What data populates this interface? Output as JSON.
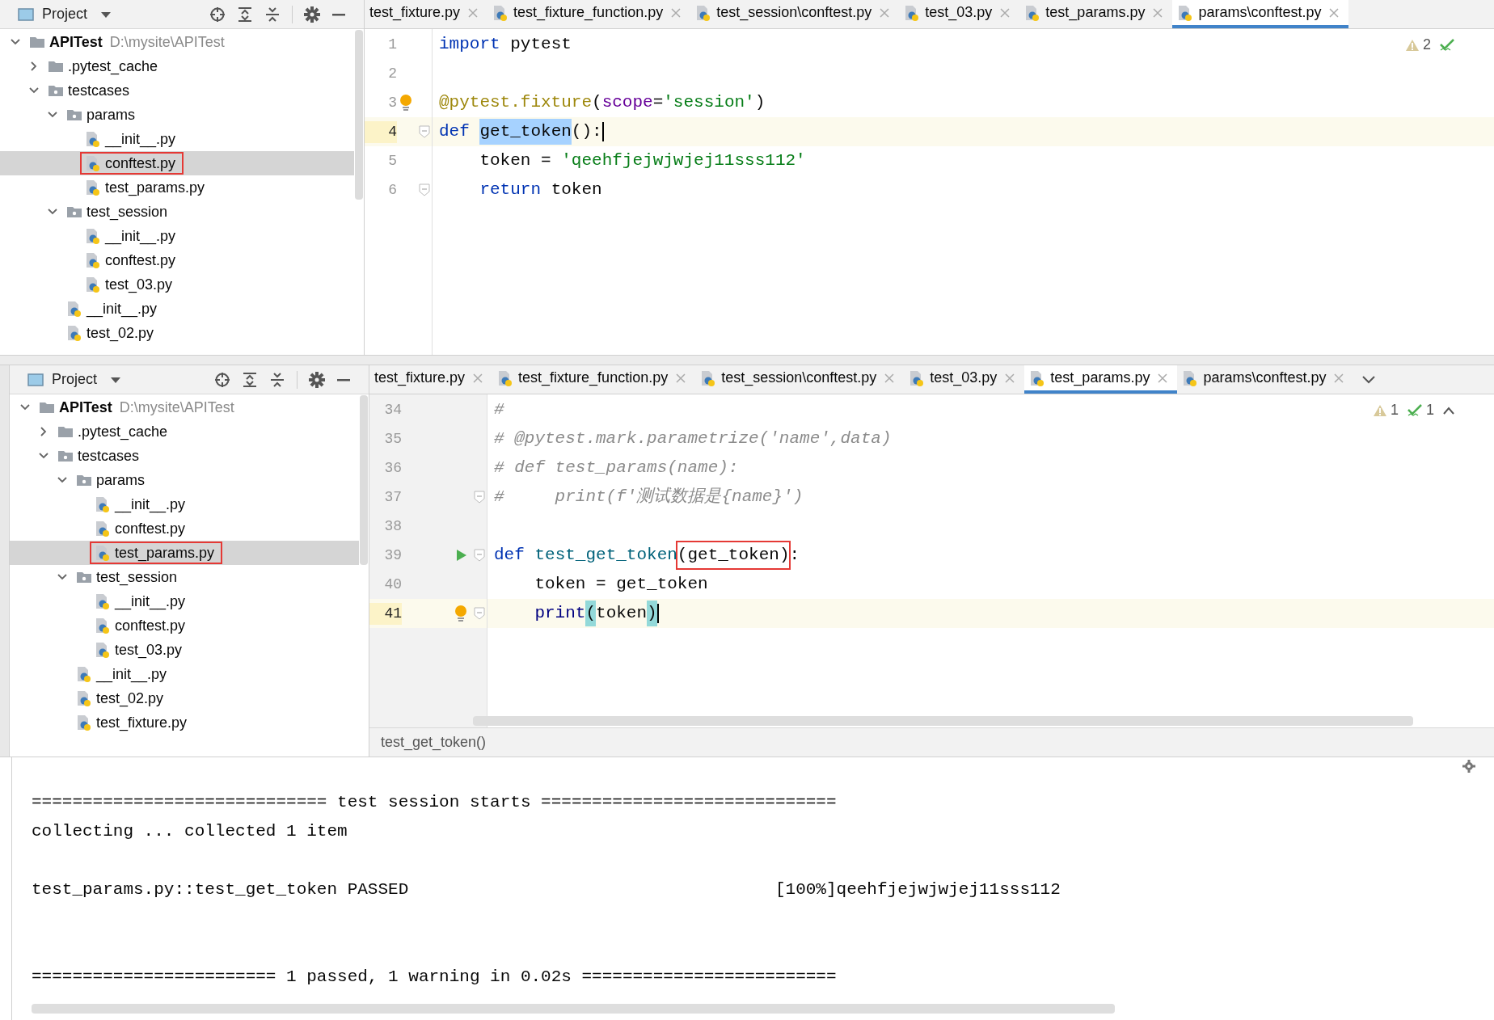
{
  "top_pane": {
    "project_panel": {
      "title": "Project",
      "tree": [
        {
          "label": "APITest",
          "path": "D:\\mysite\\APITest",
          "kind": "root",
          "expanded": true,
          "selected": false,
          "boxed": false,
          "children": [
            {
              "label": ".pytest_cache",
              "kind": "folder",
              "expanded": false,
              "selected": false,
              "boxed": false
            },
            {
              "label": "testcases",
              "kind": "package",
              "expanded": true,
              "selected": false,
              "boxed": false,
              "children": [
                {
                  "label": "params",
                  "kind": "package",
                  "expanded": true,
                  "selected": false,
                  "boxed": false,
                  "children": [
                    {
                      "label": "__init__.py",
                      "kind": "python",
                      "selected": false,
                      "boxed": false
                    },
                    {
                      "label": "conftest.py",
                      "kind": "python",
                      "selected": true,
                      "boxed": true
                    },
                    {
                      "label": "test_params.py",
                      "kind": "python",
                      "selected": false,
                      "boxed": false
                    }
                  ]
                },
                {
                  "label": "test_session",
                  "kind": "package",
                  "expanded": true,
                  "selected": false,
                  "boxed": false,
                  "children": [
                    {
                      "label": "__init__.py",
                      "kind": "python",
                      "selected": false,
                      "boxed": false
                    },
                    {
                      "label": "conftest.py",
                      "kind": "python",
                      "selected": false,
                      "boxed": false
                    },
                    {
                      "label": "test_03.py",
                      "kind": "python",
                      "selected": false,
                      "boxed": false
                    }
                  ]
                },
                {
                  "label": "__init__.py",
                  "kind": "python",
                  "selected": false,
                  "boxed": false
                },
                {
                  "label": "test_02.py",
                  "kind": "python",
                  "selected": false,
                  "boxed": false
                }
              ]
            }
          ]
        }
      ]
    },
    "tabs": [
      {
        "label": "test_fixture.py",
        "icon": false,
        "selected": false
      },
      {
        "label": "test_fixture_function.py",
        "icon": true,
        "selected": false
      },
      {
        "label": "test_session\\conftest.py",
        "icon": true,
        "selected": false
      },
      {
        "label": "test_03.py",
        "icon": true,
        "selected": false
      },
      {
        "label": "test_params.py",
        "icon": true,
        "selected": false
      },
      {
        "label": "params\\conftest.py",
        "icon": true,
        "selected": true
      }
    ],
    "inspection": {
      "warnings": "2"
    },
    "lines": [
      {
        "number": "1",
        "current": false,
        "tokens": [
          {
            "text": "import",
            "kind": "keyword"
          },
          {
            "text": " pytest",
            "kind": "plain"
          }
        ]
      },
      {
        "number": "2",
        "current": false
      },
      {
        "number": "3",
        "current": false,
        "bulb": true,
        "tokens": [
          {
            "text": "@pytest.fixture",
            "kind": "decorator"
          },
          {
            "text": "(",
            "kind": "plain"
          },
          {
            "text": "scope",
            "kind": "param"
          },
          {
            "text": "=",
            "kind": "plain"
          },
          {
            "text": "'session'",
            "kind": "string"
          },
          {
            "text": ")",
            "kind": "plain"
          }
        ]
      },
      {
        "number": "4",
        "current": true,
        "fold": true,
        "tokens": [
          {
            "text": "def ",
            "kind": "keyword"
          },
          {
            "text": "get_token",
            "kind": "plain",
            "selected": true
          },
          {
            "text": "():",
            "kind": "plain"
          }
        ]
      },
      {
        "number": "5",
        "current": false,
        "tokens": [
          {
            "text": "    token = ",
            "kind": "plain"
          },
          {
            "text": "'qeehfjejwjwjej11sss112'",
            "kind": "string"
          }
        ]
      },
      {
        "number": "6",
        "current": false,
        "fold": true,
        "tokens": [
          {
            "text": "    return",
            "kind": "keyword"
          },
          {
            "text": " token",
            "kind": "plain"
          }
        ]
      }
    ]
  },
  "bottom_pane": {
    "project_panel": {
      "title": "Project",
      "tree": [
        {
          "label": "APITest",
          "path": "D:\\mysite\\APITest",
          "kind": "root",
          "expanded": true,
          "selected": false,
          "boxed": false,
          "children": [
            {
              "label": ".pytest_cache",
              "kind": "folder",
              "expanded": false,
              "selected": false,
              "boxed": false
            },
            {
              "label": "testcases",
              "kind": "package",
              "expanded": true,
              "selected": false,
              "boxed": false,
              "children": [
                {
                  "label": "params",
                  "kind": "package",
                  "expanded": true,
                  "selected": false,
                  "boxed": false,
                  "children": [
                    {
                      "label": "__init__.py",
                      "kind": "python",
                      "selected": false,
                      "boxed": false
                    },
                    {
                      "label": "conftest.py",
                      "kind": "python",
                      "selected": false,
                      "boxed": false
                    },
                    {
                      "label": "test_params.py",
                      "kind": "python",
                      "selected": true,
                      "boxed": true
                    }
                  ]
                },
                {
                  "label": "test_session",
                  "kind": "package",
                  "expanded": true,
                  "selected": false,
                  "boxed": false,
                  "children": [
                    {
                      "label": "__init__.py",
                      "kind": "python",
                      "selected": false,
                      "boxed": false
                    },
                    {
                      "label": "conftest.py",
                      "kind": "python",
                      "selected": false,
                      "boxed": false
                    },
                    {
                      "label": "test_03.py",
                      "kind": "python",
                      "selected": false,
                      "boxed": false
                    }
                  ]
                },
                {
                  "label": "__init__.py",
                  "kind": "python",
                  "selected": false,
                  "boxed": false
                },
                {
                  "label": "test_02.py",
                  "kind": "python",
                  "selected": false,
                  "boxed": false
                },
                {
                  "label": "test_fixture.py",
                  "kind": "python",
                  "selected": false,
                  "boxed": false
                }
              ]
            }
          ]
        }
      ]
    },
    "tabs": [
      {
        "label": "test_fixture.py",
        "icon": false,
        "selected": false
      },
      {
        "label": "test_fixture_function.py",
        "icon": true,
        "selected": false
      },
      {
        "label": "test_session\\conftest.py",
        "icon": true,
        "selected": false
      },
      {
        "label": "test_03.py",
        "icon": true,
        "selected": false
      },
      {
        "label": "test_params.py",
        "icon": true,
        "selected": true
      },
      {
        "label": "params\\conftest.py",
        "icon": true,
        "selected": false
      }
    ],
    "inspection": {
      "warnings": "1",
      "passed": "1"
    },
    "lines": [
      {
        "number": "34",
        "current": false,
        "tokens": [
          {
            "text": "#",
            "kind": "comment"
          }
        ]
      },
      {
        "number": "35",
        "current": false,
        "tokens": [
          {
            "text": "# @pytest.mark.parametrize('name',data)",
            "kind": "comment"
          }
        ]
      },
      {
        "number": "36",
        "current": false,
        "tokens": [
          {
            "text": "# def test_params(name):",
            "kind": "comment"
          }
        ]
      },
      {
        "number": "37",
        "current": false,
        "fold": true,
        "tokens": [
          {
            "text": "#     print(f'测试数据是{name}')",
            "kind": "comment"
          }
        ]
      },
      {
        "number": "38",
        "current": false
      },
      {
        "number": "39",
        "current": false,
        "run": true,
        "fold": true,
        "tokens": [
          {
            "text": "def ",
            "kind": "keyword"
          },
          {
            "text": "test_get_token",
            "kind": "function"
          },
          {
            "text": "(get_token)",
            "kind": "plain",
            "boxed": true
          },
          {
            "text": ":",
            "kind": "plain"
          }
        ]
      },
      {
        "number": "40",
        "current": false,
        "tokens": [
          {
            "text": "    token = get_token",
            "kind": "plain"
          }
        ]
      },
      {
        "number": "41",
        "current": true,
        "bulb": true,
        "fold": true,
        "tokens": [
          {
            "text": "    print",
            "kind": "builtin"
          },
          {
            "text": "(",
            "kind": "plain",
            "matched": true
          },
          {
            "text": "token",
            "kind": "plain"
          },
          {
            "text": ")",
            "kind": "plain",
            "matched": true
          }
        ]
      }
    ],
    "breadcrumb": "test_get_token()"
  },
  "console": {
    "lines": [
      {
        "kind": "header",
        "text": "============================= test session starts ============================="
      },
      {
        "kind": "status",
        "text": "collecting ... collected 1 item"
      },
      {
        "kind": "result",
        "text": "test_params.py::test_get_token PASSED                                    [100%]qeehfjejwjwjej11sss112"
      },
      {
        "kind": "summary",
        "text": "======================== 1 passed, 1 warning in 0.02s ========================="
      }
    ]
  }
}
